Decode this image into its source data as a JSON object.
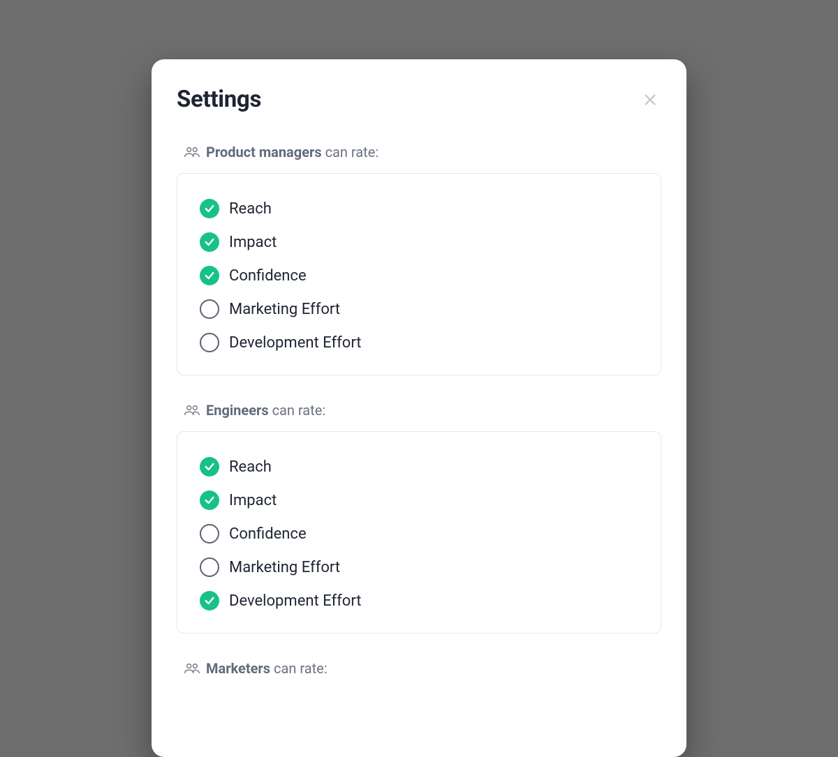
{
  "modal": {
    "title": "Settings",
    "suffix": "can rate:",
    "groups": [
      {
        "name": "Product managers",
        "options": [
          {
            "label": "Reach",
            "checked": true
          },
          {
            "label": "Impact",
            "checked": true
          },
          {
            "label": "Confidence",
            "checked": true
          },
          {
            "label": "Marketing Effort",
            "checked": false
          },
          {
            "label": "Development Effort",
            "checked": false
          }
        ]
      },
      {
        "name": "Engineers",
        "options": [
          {
            "label": "Reach",
            "checked": true
          },
          {
            "label": "Impact",
            "checked": true
          },
          {
            "label": "Confidence",
            "checked": false
          },
          {
            "label": "Marketing Effort",
            "checked": false
          },
          {
            "label": "Development Effort",
            "checked": true
          }
        ]
      },
      {
        "name": "Marketers",
        "options": []
      }
    ]
  }
}
